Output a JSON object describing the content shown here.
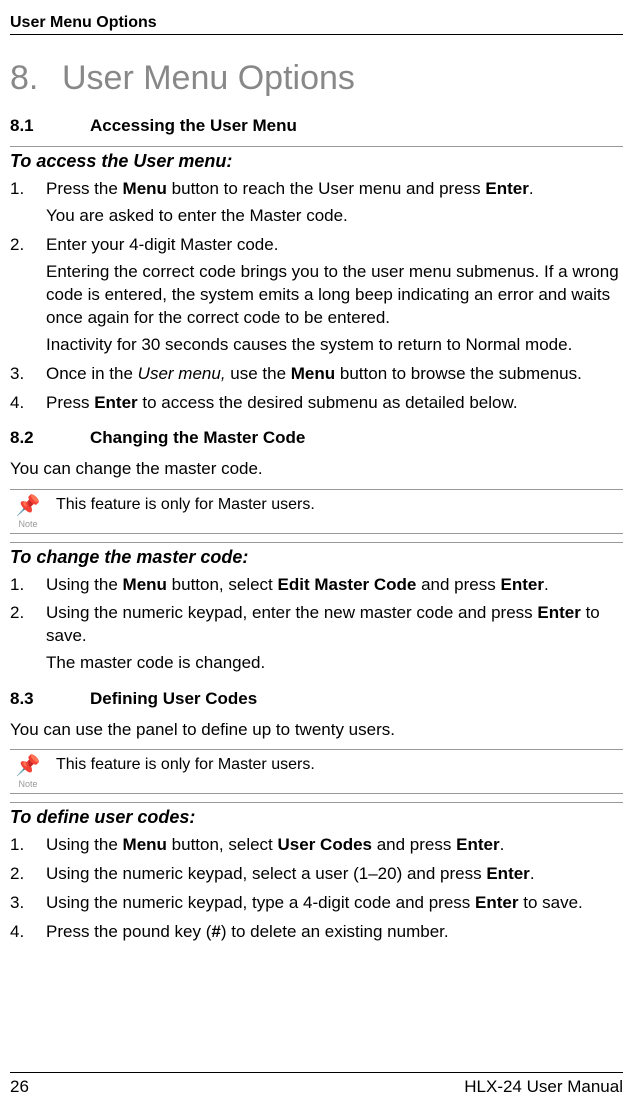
{
  "page": {
    "running_header": "User Menu Options",
    "footer_left": "26",
    "footer_right": "HLX-24 User Manual"
  },
  "chapter": {
    "number": "8.",
    "title": "User Menu Options"
  },
  "s1": {
    "num": "8.1",
    "title": "Accessing the User Menu",
    "proc_title": "To access the User menu:",
    "step1_a": "Press the ",
    "step1_b": "Menu",
    "step1_c": " button to reach the User menu and press ",
    "step1_d": "Enter",
    "step1_e": ".",
    "step1_p2": "You are asked to enter the Master code.",
    "step2_a": "Enter your 4-digit Master code.",
    "step2_p2": "Entering the correct code brings you to the user menu submenus. If a wrong code is entered, the system emits a long beep indicating an error and waits once again for the correct code to be entered.",
    "step2_p3": "Inactivity for 30 seconds causes the system to return to Normal mode.",
    "step3_a": "Once in the ",
    "step3_b": "User menu,",
    "step3_c": " use the ",
    "step3_d": "Menu",
    "step3_e": " button to browse the submenus.",
    "step4_a": "Press ",
    "step4_b": "Enter",
    "step4_c": " to access the desired submenu as detailed below."
  },
  "s2": {
    "num": "8.2",
    "title": "Changing the Master Code",
    "intro": "You can change the master code.",
    "note": "This feature is only for Master users.",
    "proc_title": "To change the master code:",
    "step1_a": "Using the ",
    "step1_b": "Menu",
    "step1_c": " button, select ",
    "step1_d": "Edit Master Code",
    "step1_e": " and press ",
    "step1_f": "Enter",
    "step1_g": ".",
    "step2_a": "Using the numeric keypad, enter the new master code and press ",
    "step2_b": "Enter",
    "step2_c": " to save.",
    "step2_p2": "The master code is changed."
  },
  "s3": {
    "num": "8.3",
    "title": "Defining User Codes",
    "intro": "You can use the panel to define up to twenty users.",
    "note": "This feature is only for Master users.",
    "proc_title": "To define user codes:",
    "step1_a": "Using the ",
    "step1_b": "Menu",
    "step1_c": " button, select ",
    "step1_d": "User Codes",
    "step1_e": " and press ",
    "step1_f": "Enter",
    "step1_g": ".",
    "step2_a": "Using the numeric keypad, select a user (1–20) and press ",
    "step2_b": "Enter",
    "step2_c": ".",
    "step3_a": "Using the numeric keypad, type a 4-digit code and press ",
    "step3_b": "Enter",
    "step3_c": " to save.",
    "step4_a": "Press the pound key (",
    "step4_b": "#",
    "step4_c": ") to delete an existing number."
  },
  "labels": {
    "note_icon": "Note",
    "n1": "1.",
    "n2": "2.",
    "n3": "3.",
    "n4": "4."
  }
}
